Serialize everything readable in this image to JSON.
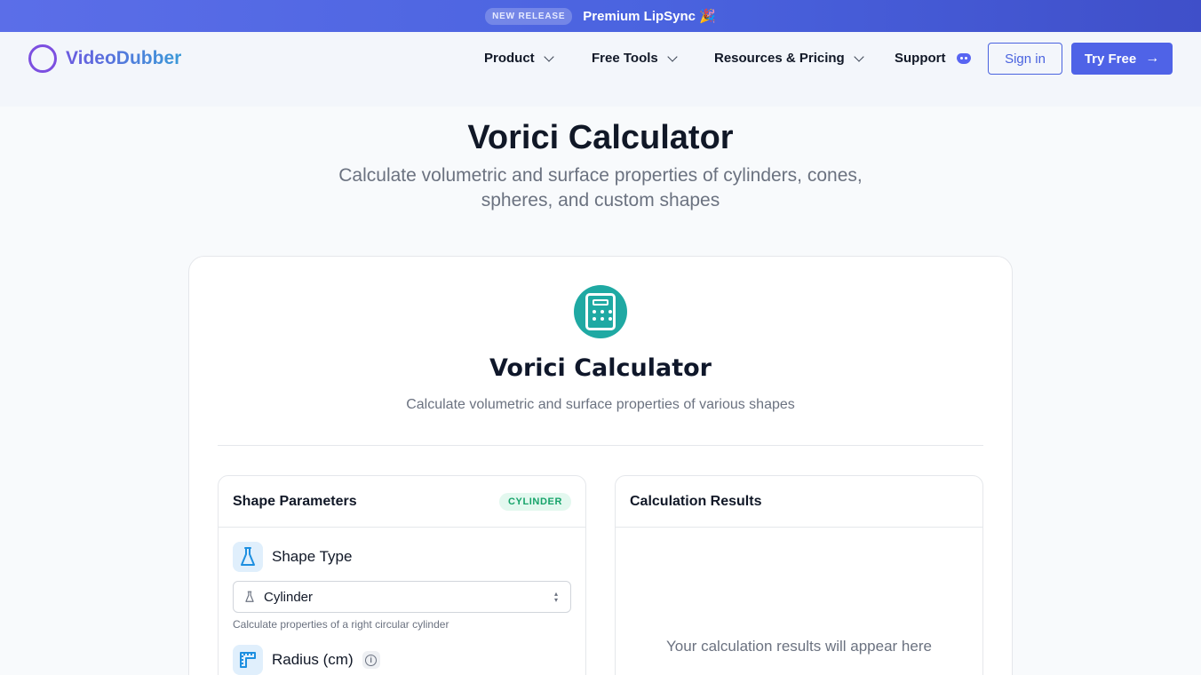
{
  "banner": {
    "badge": "NEW RELEASE",
    "text": "Premium LipSync 🎉"
  },
  "nav": {
    "logo_text": "VideoDubber",
    "items": [
      {
        "label": "Product"
      },
      {
        "label": "Free Tools"
      },
      {
        "label": "Resources & Pricing"
      },
      {
        "label": "Support"
      }
    ],
    "sign_in": "Sign in",
    "try_free": "Try Free",
    "try_free_arrow": "→"
  },
  "hero": {
    "title": "Vorici Calculator",
    "subtitle": "Calculate volumetric and surface properties of cylinders, cones, spheres, and custom shapes"
  },
  "card": {
    "title": "Vorici Calculator",
    "subtitle": "Calculate volumetric and surface properties of various shapes"
  },
  "params": {
    "title": "Shape Parameters",
    "badge": "CYLINDER",
    "shape_type_label": "Shape Type",
    "shape_value": "Cylinder",
    "shape_helper": "Calculate properties of a right circular cylinder",
    "radius_label": "Radius (cm)"
  },
  "results": {
    "title": "Calculation Results",
    "empty": "Your calculation results will appear here"
  },
  "colors": {
    "brand": "#4f63e7",
    "teal_icon": "#1fa9a3",
    "badge_green": "#16a36a"
  }
}
